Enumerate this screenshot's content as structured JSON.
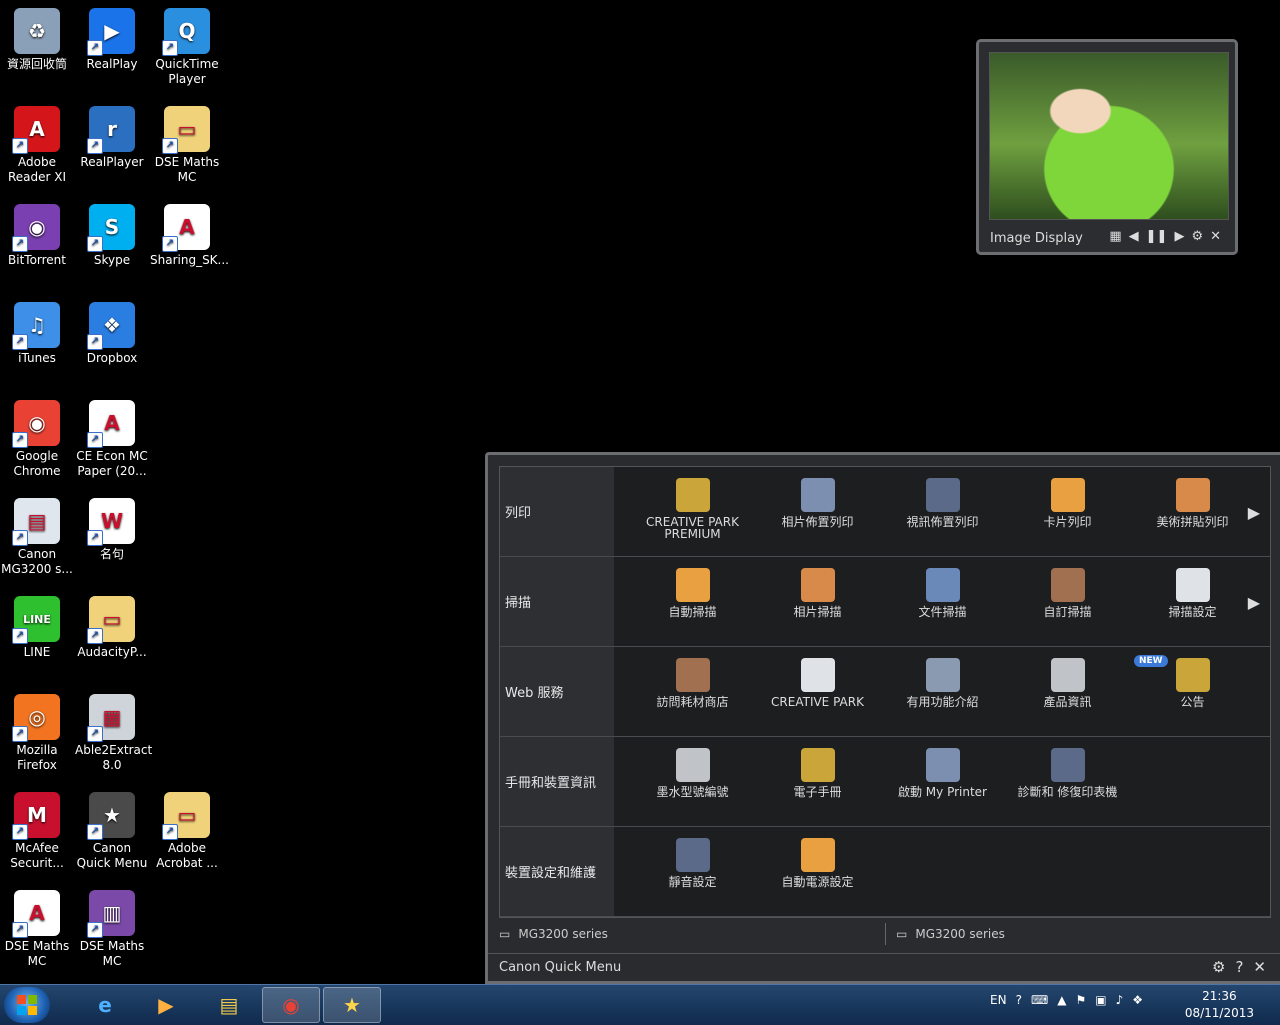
{
  "desktop": {
    "icons": [
      {
        "label": "資源回收筒",
        "icon": "recycle-bin-icon"
      },
      {
        "label": "RealPlay",
        "icon": "realplay-icon"
      },
      {
        "label": "QuickTime Player",
        "icon": "quicktime-icon"
      },
      {
        "label": "Adobe Reader XI",
        "icon": "adobe-reader-icon"
      },
      {
        "label": "RealPlayer",
        "icon": "realplayer-icon"
      },
      {
        "label": "DSE Maths MC",
        "icon": "folder-icon"
      },
      {
        "label": "BitTorrent",
        "icon": "bittorrent-icon"
      },
      {
        "label": "Skype",
        "icon": "skype-icon"
      },
      {
        "label": "Sharing_SK...",
        "icon": "pdf-file-icon"
      },
      {
        "label": "iTunes",
        "icon": "itunes-icon"
      },
      {
        "label": "Dropbox",
        "icon": "dropbox-icon"
      },
      {
        "label": "Google Chrome",
        "icon": "chrome-icon"
      },
      {
        "label": "CE Econ MC Paper (20...",
        "icon": "pdf-file-icon"
      },
      {
        "label": "Canon MG3200 s...",
        "icon": "canon-printer-icon"
      },
      {
        "label": "名句",
        "icon": "word-doc-icon"
      },
      {
        "label": "LINE",
        "icon": "line-icon"
      },
      {
        "label": "AudacityP...",
        "icon": "folder-icon"
      },
      {
        "label": "Mozilla Firefox",
        "icon": "firefox-icon"
      },
      {
        "label": "Able2Extract 8.0",
        "icon": "able2extract-icon"
      },
      {
        "label": "McAfee Securit...",
        "icon": "mcafee-icon"
      },
      {
        "label": "Canon Quick Menu",
        "icon": "canon-quick-menu-icon"
      },
      {
        "label": "Adobe Acrobat ...",
        "icon": "folder-icon"
      },
      {
        "label": "DSE Maths MC",
        "icon": "pdf-file-icon"
      },
      {
        "label": "DSE Maths MC",
        "icon": "winrar-icon"
      }
    ]
  },
  "image_display": {
    "title": "Image Display"
  },
  "quick_menu": {
    "title": "Canon Quick Menu",
    "rows": [
      {
        "category": "列印",
        "items": [
          "CREATIVE PARK PREMIUM",
          "相片佈置列印",
          "視訊佈置列印",
          "卡片列印",
          "美術拼貼列印"
        ],
        "has_arrow": true
      },
      {
        "category": "掃描",
        "items": [
          "自動掃描",
          "相片掃描",
          "文件掃描",
          "自訂掃描",
          "掃描設定"
        ],
        "has_arrow": true
      },
      {
        "category": "Web 服務",
        "items": [
          "訪問耗材商店",
          "CREATIVE PARK",
          "有用功能介紹",
          "產品資訊",
          "公告"
        ],
        "has_arrow": false,
        "badge": "NEW"
      },
      {
        "category": "手冊和裝置資訊",
        "items": [
          "墨水型號編號",
          "電子手冊",
          "啟動 My Printer",
          "診斷和 修復印表機"
        ],
        "has_arrow": false
      },
      {
        "category": "裝置設定和維護",
        "items": [
          "靜音設定",
          "自動電源設定"
        ],
        "has_arrow": false
      }
    ],
    "printers": [
      "MG3200 series",
      "MG3200 series"
    ]
  },
  "taskbar": {
    "language": "EN",
    "time": "21:36",
    "date": "08/11/2013"
  }
}
